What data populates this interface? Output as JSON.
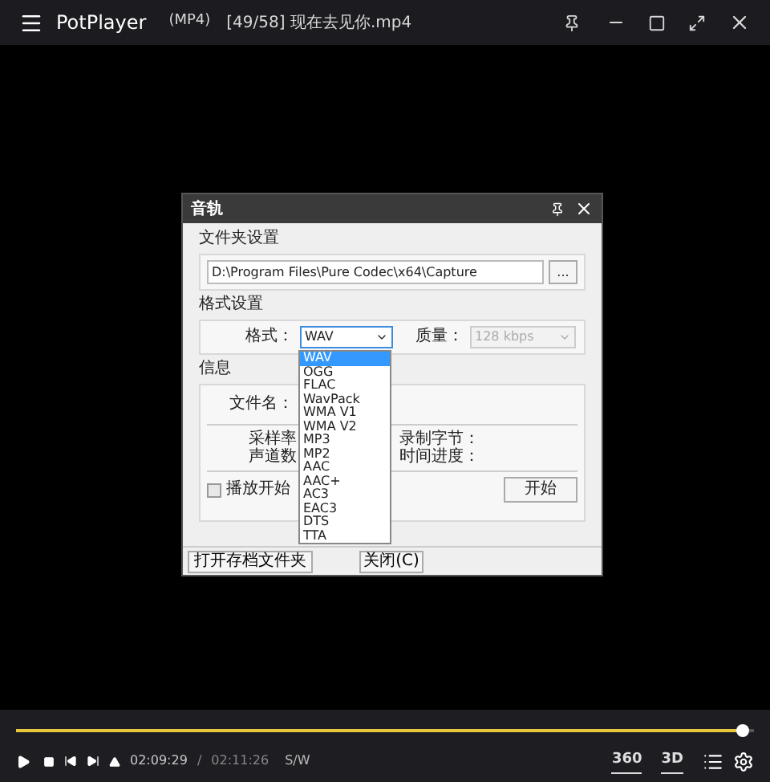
{
  "player": {
    "title": "PotPlayer",
    "format": "(MP4)",
    "file": "[49/58] 现在去见你.mp4"
  },
  "dialog": {
    "title": "音轨",
    "folder_group": {
      "title": "文件夹设置",
      "path": "D:\\Program Files\\Pure Codec\\x64\\Capture",
      "browse_button": "..."
    },
    "format_group": {
      "title": "格式设置",
      "format_label": "格式：",
      "format_value": "WAV",
      "quality_label": "质量：",
      "quality_value": "128 kbps",
      "quality_disabled": true
    },
    "info_group": {
      "title": "信息",
      "filename_label": "文件名：",
      "sample_rate_label": "采样率",
      "channels_label": "声道数",
      "recorded_bytes_label": "录制字节：",
      "time_progress_label": "时间进度：",
      "autostart_label": "播放开始",
      "autostart_checked": false,
      "start_button": "开始"
    },
    "buttons": [
      "打开存档文件夹",
      "关闭(C)"
    ],
    "format_options": [
      {
        "label": "WAV",
        "selected": true
      },
      {
        "label": "OGG",
        "selected": false
      },
      {
        "label": "FLAC",
        "selected": false
      },
      {
        "label": "WavPack",
        "selected": false
      },
      {
        "label": "WMA V1",
        "selected": false
      },
      {
        "label": "WMA V2",
        "selected": false
      },
      {
        "label": "MP3",
        "selected": false
      },
      {
        "label": "MP2",
        "selected": false
      },
      {
        "label": "AAC",
        "selected": false
      },
      {
        "label": "AAC+",
        "selected": false
      },
      {
        "label": "AC3",
        "selected": false
      },
      {
        "label": "EAC3",
        "selected": false
      },
      {
        "label": "DTS",
        "selected": false
      },
      {
        "label": "TTA",
        "selected": false
      }
    ]
  },
  "controls": {
    "progress": {
      "level": 0.985
    },
    "current_time": "02:09:29",
    "separator": "/",
    "total_time": "02:11:26",
    "mode": "S/W",
    "badges": [
      "360",
      "3D"
    ]
  }
}
